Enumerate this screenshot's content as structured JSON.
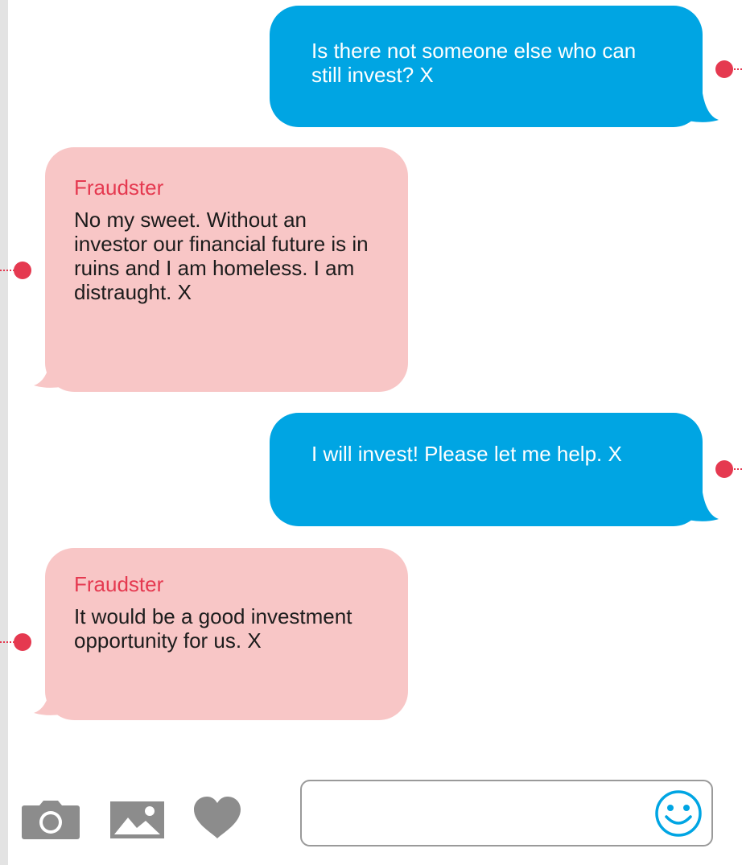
{
  "conversation": {
    "messages": [
      {
        "direction": "outgoing",
        "sender": "",
        "text": "Is there not someone else who can still invest? X"
      },
      {
        "direction": "incoming",
        "sender": "Fraudster",
        "text": "No my sweet. Without an investor our financial future is in ruins and I am homeless. I am distraught. X"
      },
      {
        "direction": "outgoing",
        "sender": "",
        "text": "I will invest! Please let me help. X"
      },
      {
        "direction": "incoming",
        "sender": "Fraudster",
        "text": "It would be a good investment opportunity for us. X"
      }
    ]
  },
  "composer": {
    "value": "",
    "icons": [
      "camera-icon",
      "image-icon",
      "heart-icon",
      "smiley-emoji-icon"
    ]
  },
  "colors": {
    "outgoing_bubble": "#00a5e3",
    "incoming_bubble": "#f8c6c6",
    "sender_name": "#e53950",
    "marker": "#e53950",
    "icon_gray": "#8c8c8c",
    "emoji_blue": "#00a5e3"
  }
}
